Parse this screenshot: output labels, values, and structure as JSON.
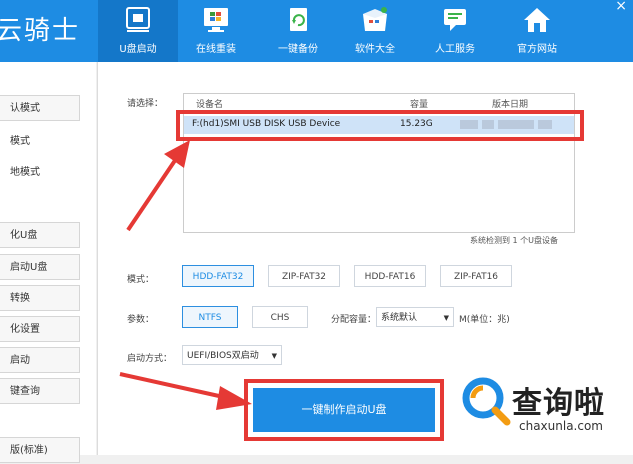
{
  "header": {
    "app_title": "云骑士",
    "nav": [
      {
        "label": "U盘启动",
        "icon": "usb-drive-icon",
        "active": true
      },
      {
        "label": "在线重装",
        "icon": "windows-monitor-icon"
      },
      {
        "label": "一键备份",
        "icon": "backup-document-icon"
      },
      {
        "label": "软件大全",
        "icon": "software-box-icon"
      },
      {
        "label": "人工服务",
        "icon": "chat-support-icon"
      },
      {
        "label": "官方网站",
        "icon": "home-icon"
      }
    ],
    "close_label": "×"
  },
  "sidebar": {
    "items": [
      {
        "label": "  认模式"
      },
      {
        "label": "  模式"
      },
      {
        "label": "  地模式"
      },
      {
        "label": "  化U盘"
      },
      {
        "label": "  启动U盘"
      },
      {
        "label": "  转换"
      },
      {
        "label": "  化设置"
      },
      {
        "label": "  启动"
      },
      {
        "label": "  键查询"
      },
      {
        "label": "  版(标准)"
      }
    ]
  },
  "main": {
    "select_label": "请选择：",
    "table": {
      "headers": [
        "设备名",
        "容量",
        "版本日期"
      ],
      "rows": [
        {
          "device": "F:(hd1)SMI USB DISK USB Device",
          "capacity": "15.23G",
          "date": ""
        }
      ]
    },
    "detect_text": "系统检测到 1 个U盘设备",
    "mode_label": "模式：",
    "modes": [
      "HDD-FAT32",
      "ZIP-FAT32",
      "HDD-FAT16",
      "ZIP-FAT16"
    ],
    "params_label": "参数：",
    "params": [
      "NTFS",
      "CHS"
    ],
    "alloc_label": "分配容量：",
    "alloc_value": "系统默认",
    "unit_label": "M(单位：兆)",
    "boot_label": "启动方式：",
    "boot_value": "UEFI/BIOS双启动",
    "make_button": "一键制作启动U盘"
  },
  "watermark": {
    "text": "查询啦",
    "sub": "chaxunla.com"
  },
  "colors": {
    "brand": "#1e8ce3",
    "highlight": "#e53935",
    "selected_row": "#cfe3f8"
  }
}
